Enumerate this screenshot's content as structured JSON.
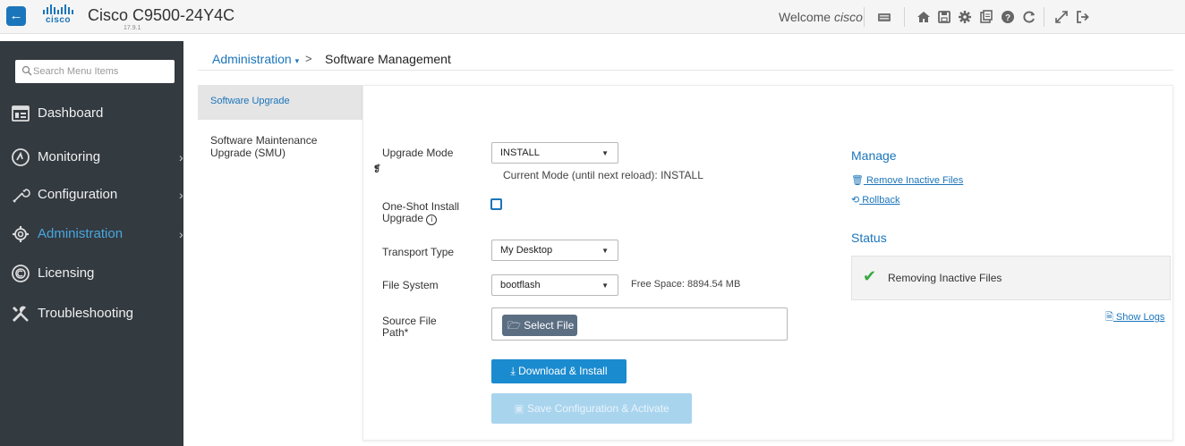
{
  "header": {
    "brand": "cisco",
    "device_name": "Cisco C9500-24Y4C",
    "version": "17.9.1",
    "welcome_prefix": "Welcome",
    "username": "cisco"
  },
  "sidebar": {
    "search_placeholder": "Search Menu Items",
    "items": [
      {
        "label": "Dashboard"
      },
      {
        "label": "Monitoring"
      },
      {
        "label": "Configuration"
      },
      {
        "label": "Administration"
      },
      {
        "label": "Licensing"
      },
      {
        "label": "Troubleshooting"
      }
    ]
  },
  "breadcrumb": {
    "parent": "Administration",
    "separator": ">",
    "current": "Software Management"
  },
  "subnav": {
    "items": [
      {
        "label": "Software Upgrade"
      },
      {
        "label": "Software Maintenance Upgrade (SMU)"
      }
    ]
  },
  "form": {
    "upgrade_mode_label": "Upgrade Mode",
    "upgrade_mode_value": "INSTALL",
    "current_mode_note": "Current Mode (until next reload): INSTALL",
    "one_shot_label": "One-Shot Install Upgrade",
    "transport_label": "Transport Type",
    "transport_value": "My Desktop",
    "filesystem_label": "File System",
    "filesystem_value": "bootflash",
    "free_space": "Free Space: 8894.54 MB",
    "source_label": "Source File Path*",
    "select_file": "Select File",
    "download_install": "Download & Install",
    "save_activate": "Save Configuration & Activate"
  },
  "manage": {
    "title": "Manage",
    "remove_inactive": "Remove Inactive Files",
    "rollback": "Rollback"
  },
  "status": {
    "title": "Status",
    "message": "Removing Inactive Files",
    "show_logs": "Show Logs"
  },
  "colors": {
    "accent": "#1b75bb",
    "sidebar_bg": "#333a40",
    "active_nav": "#49a7e0",
    "success": "#3aa845"
  }
}
